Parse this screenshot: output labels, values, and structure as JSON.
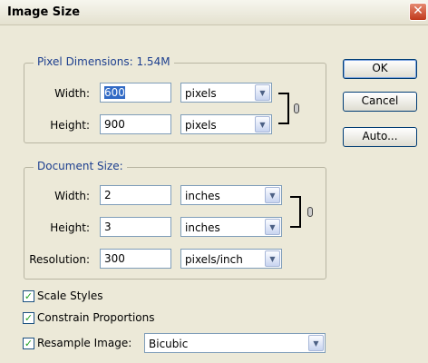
{
  "window": {
    "title": "Image Size",
    "close_glyph": "✕"
  },
  "pixel_dimensions": {
    "label": "Pixel Dimensions:",
    "size": "1.54M",
    "width_label": "Width:",
    "width_value": "600",
    "width_unit": "pixels",
    "height_label": "Height:",
    "height_value": "900",
    "height_unit": "pixels"
  },
  "document_size": {
    "label": "Document Size:",
    "width_label": "Width:",
    "width_value": "2",
    "width_unit": "inches",
    "height_label": "Height:",
    "height_value": "3",
    "height_unit": "inches",
    "resolution_label": "Resolution:",
    "resolution_value": "300",
    "resolution_unit": "pixels/inch"
  },
  "buttons": {
    "ok": "OK",
    "cancel": "Cancel",
    "auto": "Auto..."
  },
  "options": {
    "scale_styles": {
      "label": "Scale Styles",
      "checked": true
    },
    "constrain_proportions": {
      "label": "Constrain Proportions",
      "checked": true
    },
    "resample_image": {
      "label": "Resample Image:",
      "checked": true,
      "method": "Bicubic"
    }
  },
  "icons": {
    "check": "✓",
    "dropdown_arrow": "▼",
    "link": "chain-link-icon"
  },
  "colors": {
    "group_label": "#1d3f8f",
    "dialog_bg": "#ece9d8",
    "close_button": "#c0391b",
    "checkmark": "#21a121"
  }
}
